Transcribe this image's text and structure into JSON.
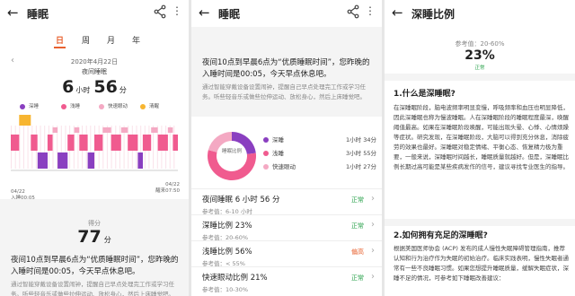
{
  "panel1": {
    "title": "睡眠",
    "tabs": [
      "日",
      "周",
      "月",
      "年"
    ],
    "date": "2020年4月22日",
    "night_label": "夜间睡眠",
    "hours": "6",
    "hours_unit": "小时",
    "minutes": "56",
    "minutes_unit": "分",
    "legend": [
      "深睡",
      "浅睡",
      "快速眼动",
      "清醒"
    ],
    "start_date": "04/22",
    "start_time": "入睡00:05",
    "end_date": "04/22",
    "end_time": "醒来07:50",
    "score_label": "得分",
    "score": "77",
    "score_unit": "分",
    "advice": "夜间10点到早晨6点为“优质睡眠时间”，您昨晚的入睡时间是00:05，今天早点休息吧。",
    "advice_sub": "通过智能穿戴设备设置闹钟，提醒自己早点处理完工作或学习任务。听些轻音乐或做些拉伸运动、放松身心，然后上床睡觉吧。"
  },
  "panel2": {
    "title": "睡眠",
    "advice": "夜间10点到早晨6点为“优质睡眠时间”，您昨晚的入睡时间是00:05，今天早点休息吧。",
    "advice_sub": "通过智能穿戴设备设置闹钟，提醒自己早点处理完工作或学习任务。听些轻音乐或做些拉伸运动、放松身心，然后上床睡觉吧。",
    "donut_center": "睡眠比例",
    "legend": [
      {
        "name": "深睡",
        "time": "1小时 34分"
      },
      {
        "name": "浅睡",
        "time": "3小时 55分"
      },
      {
        "name": "快速眼动",
        "time": "1小时 27分"
      }
    ],
    "rows": [
      {
        "label": "夜间睡眠  6 小时 56 分",
        "sub": "参考值：6-10 小时",
        "status": "正常"
      },
      {
        "label": "深睡比例  23%",
        "sub": "参考值：20-60%",
        "status": "正常"
      },
      {
        "label": "浅睡比例  56%",
        "sub": "参考值：< 55%",
        "status": "偏高"
      },
      {
        "label": "快速眼动比例  21%",
        "sub": "参考值：10-30%",
        "status": "正常"
      }
    ]
  },
  "panel3": {
    "title": "深睡比例",
    "ref": "参考值：20-60%",
    "value": "23%",
    "status": "正常",
    "q1": "1.什么是深睡眠?",
    "p1": "在深睡眠阶段，脑电波频率明显变慢，呼吸频率和血压也明显降低，因此深睡眠也称为慢波睡眠。人在深睡眠阶段的睡眠程度最深，唤醒阈值最高。如果在深睡眠阶段唤醒，可能出现头晕、心悸、心情烦躁等症状。研究发现，在深睡眠阶段，大脑可以得到充分休息，消除疲劳的效果也最好。深睡眠对稳定情绪、平衡心态、恢复精力极为重要，一般来说，深睡眠时间越长，睡眠质量就越好。但是，深睡眠比例长期过高可能是某些疾病发作的信号，建议寻找专业医生的指导。",
    "q2": "2.如何拥有充足的深睡眠?",
    "p2": "根据美国医师协会 (ACP) 发布的成人慢性失眠障碍管理指南，推荐认知和行为治疗作为失眠的初始治疗。临床实践表明，慢性失眠者通常有一些不良睡眠习惯。如果您想提升睡眠质量，缓解失眠症状，深睡不足的情况，可参考如下睡眠改善建议："
  },
  "chart_data": {
    "type": "timeline",
    "title": "夜间睡眠",
    "start": "00:05",
    "end": "07:50",
    "stages": [
      "深睡",
      "浅睡",
      "快速眼动",
      "清醒"
    ],
    "colors": {
      "深睡": "#8a3fc0",
      "浅睡": "#f05b8f",
      "快速眼动": "#f4a9c3",
      "清醒": "#f7b531"
    },
    "summary": [
      {
        "stage": "深睡",
        "duration": "1小时 34分",
        "percent": 23
      },
      {
        "stage": "浅睡",
        "duration": "3小时 55分",
        "percent": 56
      },
      {
        "stage": "快速眼动",
        "duration": "1小时 27分",
        "percent": 21
      }
    ]
  }
}
